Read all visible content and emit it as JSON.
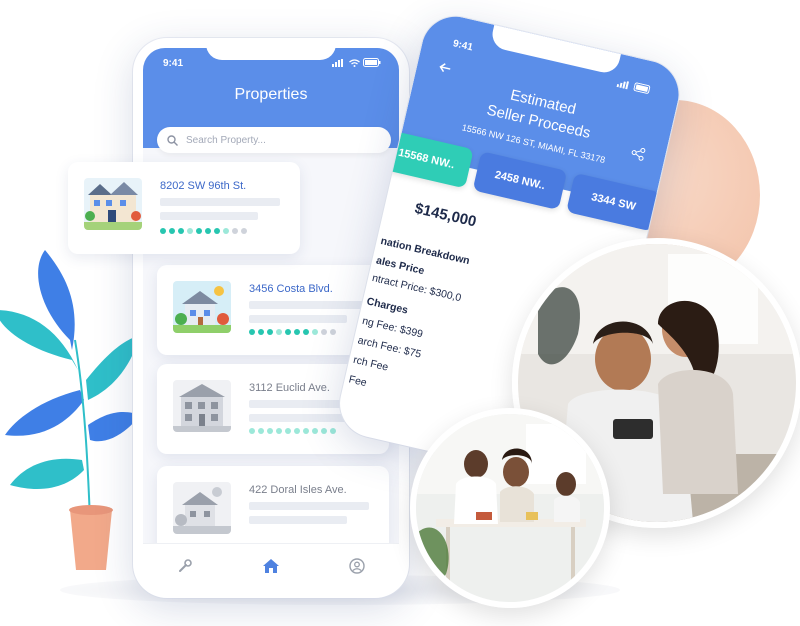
{
  "left_phone": {
    "status_time": "9:41",
    "title": "Properties",
    "search_placeholder": "Search Property...",
    "properties": [
      {
        "address": "8202 SW 96th St."
      },
      {
        "address": "3456 Costa Blvd."
      },
      {
        "address": "3112 Euclid Ave."
      },
      {
        "address": "422 Doral Isles Ave."
      }
    ],
    "tab_icons": [
      "wrench-icon",
      "home-icon",
      "user-icon"
    ]
  },
  "right_phone": {
    "status_time": "9:41",
    "title_line1": "Estimated",
    "title_line2": "Seller Proceeds",
    "address": "15566 NW 126 ST, MIAMI, FL 33178",
    "tabs": [
      "15568 NW..",
      "2458 NW..",
      "3344 SW"
    ],
    "amount": "$145,000",
    "lines": [
      "nation Breakdown",
      "ales Price",
      "ntract Price: $300,0",
      "Charges",
      "ng Fee: $399",
      "arch Fee: $75",
      "rch Fee",
      "Fee"
    ]
  },
  "colors": {
    "primary": "#5b8ee9",
    "accent": "#2fcdb6",
    "peach": "#f3c2a8"
  }
}
